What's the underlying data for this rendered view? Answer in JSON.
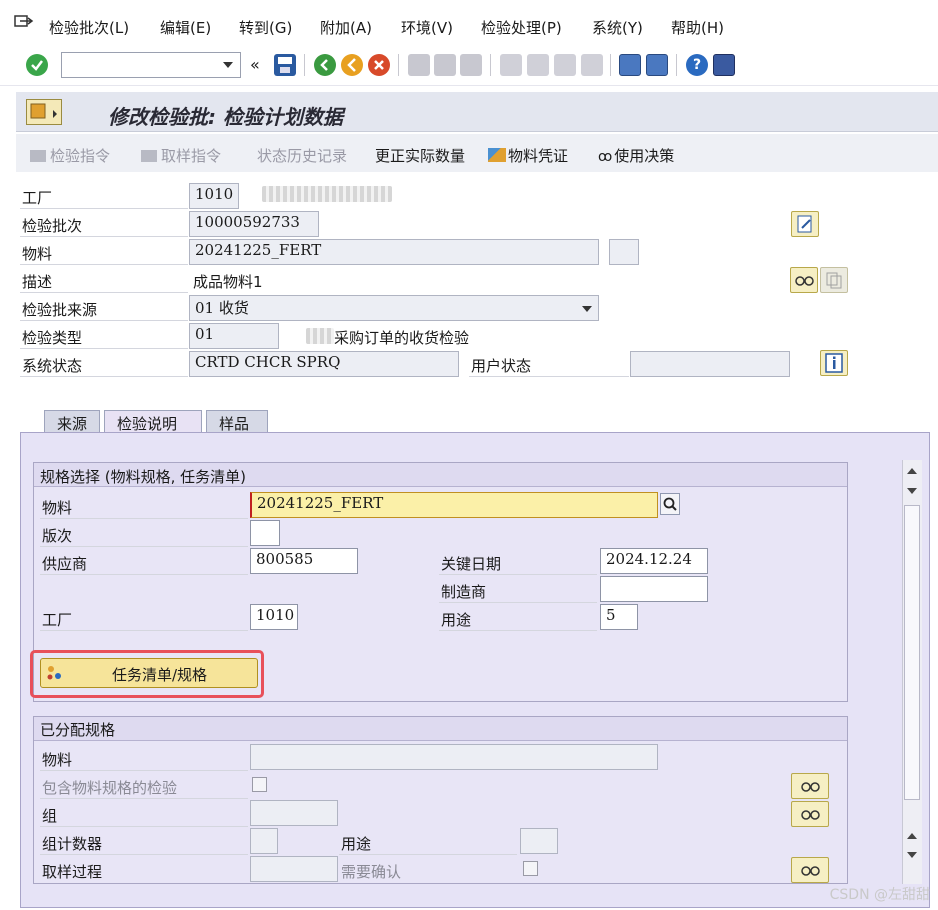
{
  "menu": {
    "items": [
      "检验批次(L)",
      "编辑(E)",
      "转到(G)",
      "附加(A)",
      "环境(V)",
      "检验处理(P)",
      "系统(Y)",
      "帮助(H)"
    ]
  },
  "toolbar": {
    "command_value": "",
    "icons": [
      "check-icon",
      "dropdown-icon",
      "back-double-icon",
      "save-icon",
      "green-back-icon",
      "exit-icon",
      "cancel-icon",
      "print-icon",
      "find-icon",
      "find-next-icon",
      "first-page-icon",
      "prev-page-icon",
      "next-page-icon",
      "last-page-icon",
      "new-session-icon",
      "shortcut-icon",
      "help-icon",
      "customize-icon"
    ]
  },
  "title": "修改检验批: 检验计划数据",
  "app_toolbar": {
    "inspection_instruction": "检验指令",
    "sample_instruction": "取样指令",
    "status_history": "状态历史记录",
    "correct_quantity": "更正实际数量",
    "material_document": "物料凭证",
    "usage_decision": "使用决策"
  },
  "header": {
    "plant_label": "工厂",
    "plant_value": "1010",
    "lot_label": "检验批次",
    "lot_value": "10000592733",
    "material_label": "物料",
    "material_value": "20241225_FERT",
    "description_label": "描述",
    "description_value": "成品物料1",
    "origin_label": "检验批来源",
    "origin_value": "01 收货",
    "type_label": "检验类型",
    "type_value": "01",
    "type_text": "采购订单的收货检验",
    "sys_status_label": "系统状态",
    "sys_status_value": "CRTD  CHCR  SPRQ",
    "user_status_label": "用户状态",
    "user_status_value": ""
  },
  "tabs": [
    "来源",
    "检验说明",
    "样品"
  ],
  "spec_group": {
    "title": "规格选择 (物料规格, 任务清单)",
    "material_label": "物料",
    "material_value": "20241225_FERT",
    "revision_label": "版次",
    "revision_value": "",
    "vendor_label": "供应商",
    "vendor_value": "800585",
    "key_date_label": "关键日期",
    "key_date_value": "2024.12.24",
    "manufacturer_label": "制造商",
    "manufacturer_value": "",
    "plant_label": "工厂",
    "plant_value": "1010",
    "usage_label": "用途",
    "usage_value": "5",
    "task_list_button": "任务清单/规格"
  },
  "assigned_group": {
    "title": "已分配规格",
    "material_label": "物料",
    "material_value": "",
    "incl_spec_label": "包含物料规格的检验",
    "group_label": "组",
    "group_value": "",
    "counter_label": "组计数器",
    "counter_value": "",
    "usage_label": "用途",
    "usage_value": "",
    "sampling_label": "取样过程",
    "sampling_value": "",
    "confirm_label": "需要确认"
  },
  "watermark": "CSDN @左甜甜",
  "colors": {
    "accent_yellow": "#f6e49a",
    "highlight_frame": "#e8505a",
    "tab_pane": "#e6e3f6"
  }
}
